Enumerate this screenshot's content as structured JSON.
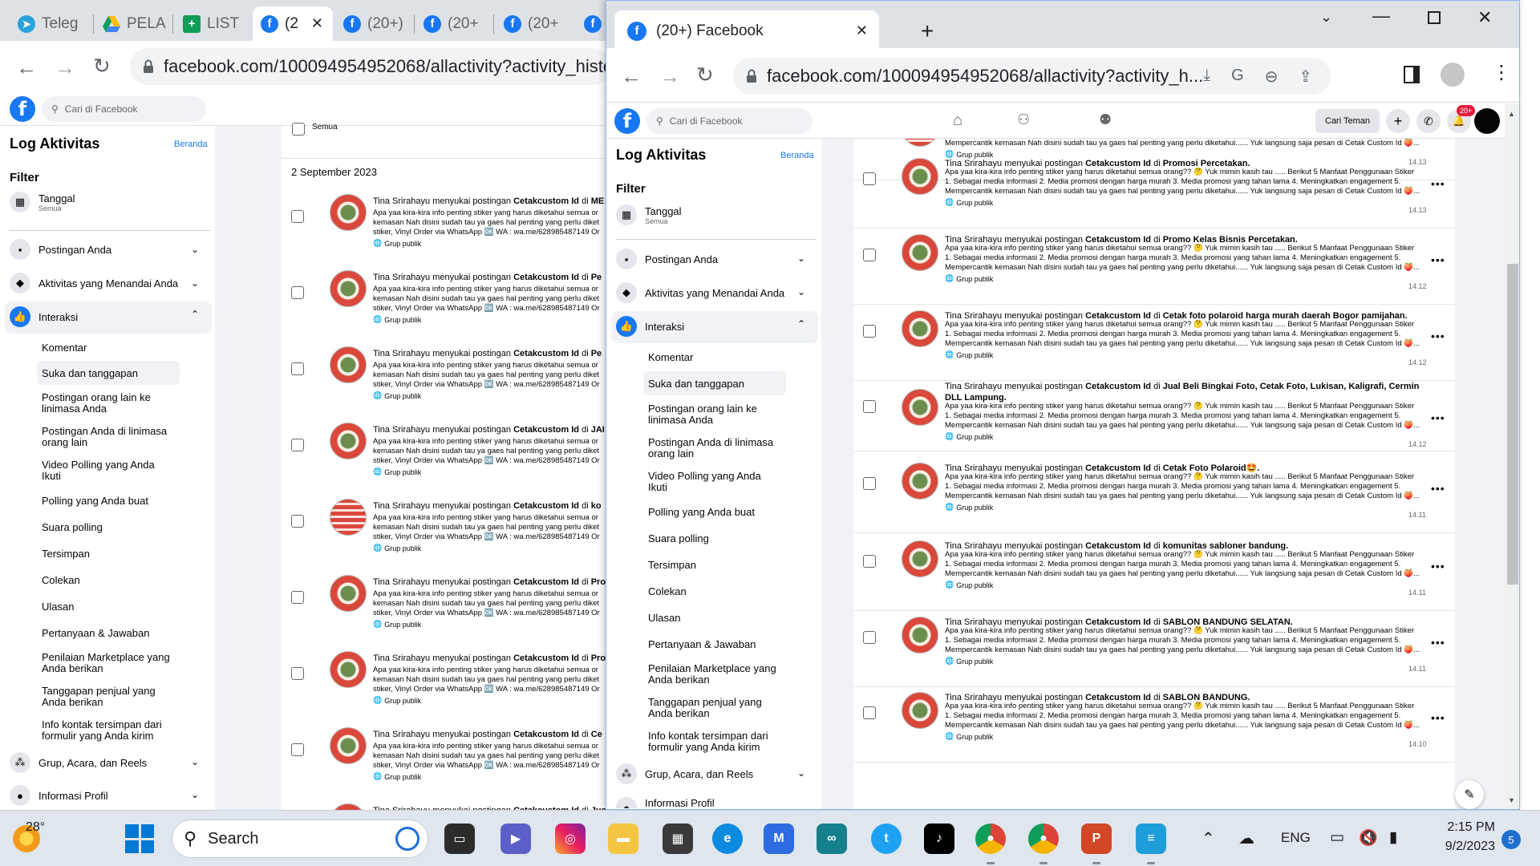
{
  "back_browser": {
    "tabs": [
      {
        "title": "Teleg",
        "icon": "telegram-icon"
      },
      {
        "title": "PELA",
        "icon": "google-drive-icon"
      },
      {
        "title": "LIST",
        "icon": "google-sheets-icon"
      },
      {
        "title": "(2",
        "icon": "facebook-icon"
      },
      {
        "title": "(20+)",
        "icon": "facebook-icon"
      },
      {
        "title": "(20+",
        "icon": "facebook-icon"
      },
      {
        "title": "(20+",
        "icon": "facebook-icon"
      }
    ],
    "url": "facebook.com/100094954952068/allactivity?activity_histor",
    "search_placeholder": "Cari di Facebook",
    "date_header": "2 September 2023",
    "select_all": "Semua"
  },
  "front_browser": {
    "tab_title": "(20+) Facebook",
    "url": "facebook.com/100094954952068/allactivity?activity_h...",
    "search_placeholder": "Cari di Facebook",
    "find_friends": "Cari Teman",
    "notification_badge": "20+"
  },
  "sidebar": {
    "title": "Log Aktivitas",
    "home_link": "Beranda",
    "filter_label": "Filter",
    "date_filter": {
      "label": "Tanggal",
      "value": "Semua"
    },
    "sections": [
      {
        "label": "Postingan Anda",
        "icon": "comment-icon"
      },
      {
        "label": "Aktivitas yang Menandai Anda",
        "icon": "tag-icon"
      },
      {
        "label": "Interaksi",
        "icon": "thumbs-up-icon"
      }
    ],
    "sub_items": [
      "Komentar",
      "Suka dan tanggapan",
      "Postingan orang lain ke linimasa Anda",
      "Postingan Anda di linimasa orang lain",
      "Video Polling yang Anda Ikuti",
      "Polling yang Anda buat",
      "Suara polling",
      "Tersimpan",
      "Colekan",
      "Ulasan",
      "Pertanyaan & Jawaban",
      "Penilaian Marketplace yang Anda berikan",
      "Tanggapan penjual yang Anda berikan",
      "Info kontak tersimpan dari formulir yang Anda kirim"
    ],
    "groups_section": "Grup, Acara, dan Reels",
    "profile_section": "Informasi Profil",
    "profile_section_partial": "Informasi Profil"
  },
  "activity": {
    "actor": "Tina Srirahayu",
    "verb": "menyukai postingan",
    "page": "Cetakcustom Id",
    "prep": "di",
    "body_line1": "Apa yaa kira-kira info penting stiker yang harus diketahui semua orang?? 🤔 Yuk mimin kasih tau ..... Berikut 5 Manfaat Penggunaan Stiker",
    "body_line2": "1. Sebagai media informasi 2. Media promosi dengan harga murah 3. Media promosi yang tahan lama 4. Meningkatkan engagement 5.",
    "body_line3": "Mempercantik kemasan Nah disini sudah tau ya gaes hal penting yang perlu diketahui...... Yuk langsung saja pesan di Cetak Custom Id 🍑...",
    "audience": "Grup publik",
    "back_body_line1": "Apa yaa kira-kira info penting stiker yang harus diketahui semua or",
    "back_body_line2": "kemasan Nah disini sudah tau ya gaes hal penting yang perlu diket",
    "back_body_line3": "stiker, Vinyl Order via WhatsApp 🆗 WA : wa.me/628985487149 Or",
    "back_groups": [
      "ME",
      "Pe",
      "Pe",
      "JAI",
      "ko",
      "Pro",
      "Pro",
      "Ce",
      "Jua"
    ],
    "front_items": [
      {
        "group": "",
        "time": "14.13"
      },
      {
        "group": "Promosi Percetakan.",
        "time": "14.13"
      },
      {
        "group": "Promo Kelas Bisnis Percetakan.",
        "time": "14.12"
      },
      {
        "group": "Cetak foto polaroid harga murah daerah Bogor pamijahan.",
        "time": "14.12"
      },
      {
        "group": "Jual Beli Bingkai Foto, Cetak Foto, Lukisan, Kaligrafi, Cermin DLL Lampung.",
        "time": "14.12"
      },
      {
        "group": "Cetak Foto Polaroid🤩.",
        "time": "14.11"
      },
      {
        "group": "komunitas sabloner bandung.",
        "time": "14.11"
      },
      {
        "group": "SABLON BANDUNG SELATAN.",
        "time": "14.11"
      },
      {
        "group": "SABLON BANDUNG.",
        "time": "14.10"
      }
    ]
  },
  "taskbar": {
    "weather_temp": "28°",
    "search_label": "Search",
    "language": "ENG",
    "time": "2:15 PM",
    "date": "9/2/2023",
    "notification_count": "5"
  }
}
